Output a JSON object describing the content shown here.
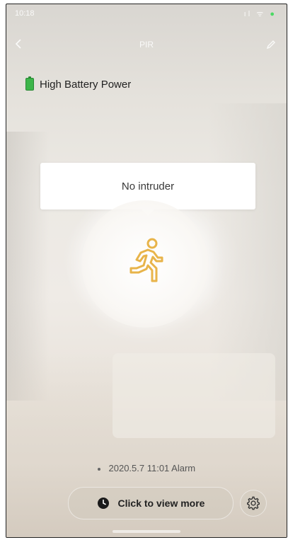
{
  "status_bar": {
    "time": "10:18",
    "icons": "ıl ᯤ",
    "battery": "●"
  },
  "nav": {
    "title": "PIR",
    "back_icon": "chevron-left-icon",
    "edit_icon": "pencil-icon"
  },
  "battery": {
    "icon": "battery-icon",
    "label": "High Battery Power",
    "color": "#3db54a"
  },
  "detection": {
    "status": "No intruder",
    "icon": "running-person-icon",
    "icon_color": "#e8b44a"
  },
  "alarm": {
    "entry": "2020.5.7 11:01 Alarm"
  },
  "actions": {
    "view_more_label": "Click to view more",
    "view_more_icon": "clock-icon",
    "settings_icon": "gear-icon"
  }
}
